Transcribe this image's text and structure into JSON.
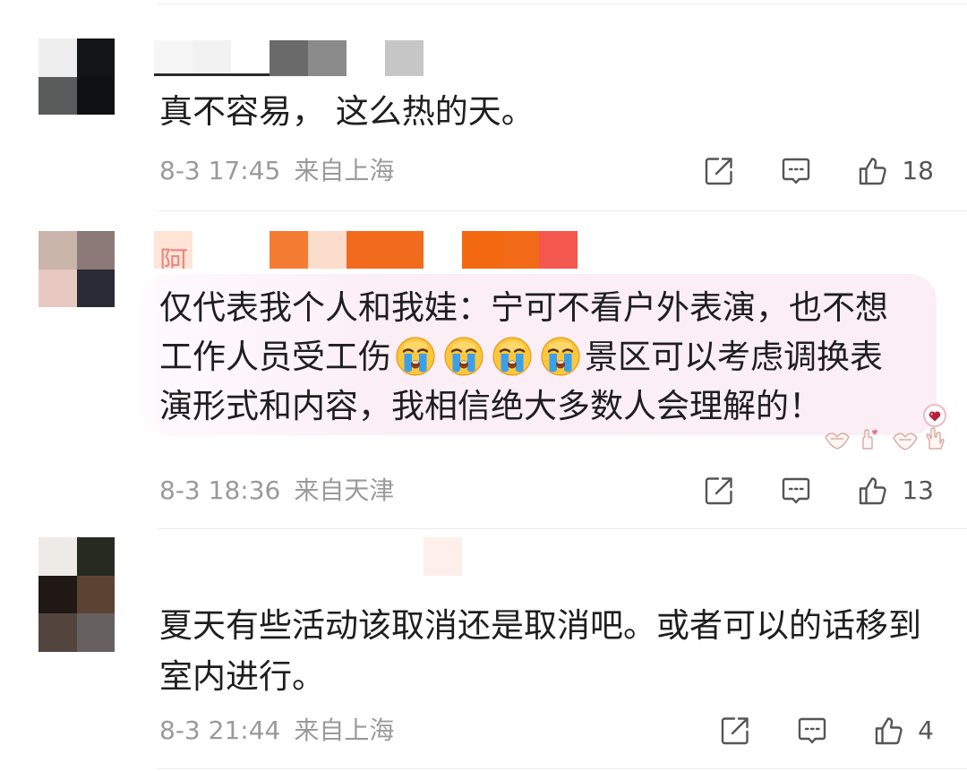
{
  "comments": [
    {
      "avatar_colors": [
        [
          "#eeeeee",
          "#121417"
        ],
        [
          "#595c5b",
          "#0f1114"
        ]
      ],
      "username_mosaic": [
        {
          "color": "#f6f6f6",
          "edge": "#2b2b2b"
        },
        {
          "color": "#f2f2f2",
          "edge": "#2b2b2b"
        },
        {
          "color": "#ffffff",
          "edge": "#2b2b2b"
        },
        "#6a6a6a",
        "#8b8b8b",
        "#ffffff",
        "#c6c6c6"
      ],
      "text": "真不容易， 这么热的天。",
      "time": "8-3 17:45",
      "location": "来自上海",
      "like_count": "18"
    },
    {
      "avatar_colors": [
        [
          "#cab5aa",
          "#8b7a77"
        ],
        [
          "#e8c9c2",
          "#292c37"
        ]
      ],
      "username_fragment": "阿",
      "username_mosaic": [
        "#fde5d8",
        "#ffffff",
        "#ffffff",
        "#f47c33",
        "#fcdccb",
        "#f26b1d",
        "#f26b1d",
        "#ffffff",
        "#f2690f",
        "#f26a16",
        "#f3574e"
      ],
      "text_before": "仅代表我个人和我娃：宁可不看户外表演，也不想工作人员受工伤",
      "emoji": [
        "crying-face-icon",
        "crying-face-icon",
        "crying-face-icon",
        "crying-face-icon"
      ],
      "text_after": "景区可以考虑调换表演形式和内容，我相信绝大多数人会理解的！",
      "stickers": [
        "heart-badge-icon",
        "heart-hands-icon"
      ],
      "time": "8-3 18:36",
      "location": "来自天津",
      "like_count": "13"
    },
    {
      "avatar_colors": [
        [
          "#eeeae5",
          "#262a20"
        ],
        [
          "#1f1815",
          "#5b4333"
        ],
        [
          "#52453d",
          "#676061"
        ]
      ],
      "username_mosaic": [
        "#ffffff",
        "#ffffff",
        "#ffffff",
        "#ffffff",
        "#ffffff",
        "#ffffff",
        "#ffffff",
        "#fdf0ea"
      ],
      "text": "夏天有些活动该取消还是取消吧。或者可以的话移到室内进行。",
      "time": "8-3 21:44",
      "location": "来自上海",
      "like_count": "4"
    }
  ],
  "actions": {
    "share_icon": "share-icon",
    "comment_icon": "comment-icon",
    "like_icon": "like-icon"
  },
  "colors": {
    "text": "#1e1e1e",
    "meta": "#9a9a9a",
    "count": "#555555",
    "icon": "#555555",
    "divider": "#eeeeee",
    "bubble": "#fbeef5"
  }
}
